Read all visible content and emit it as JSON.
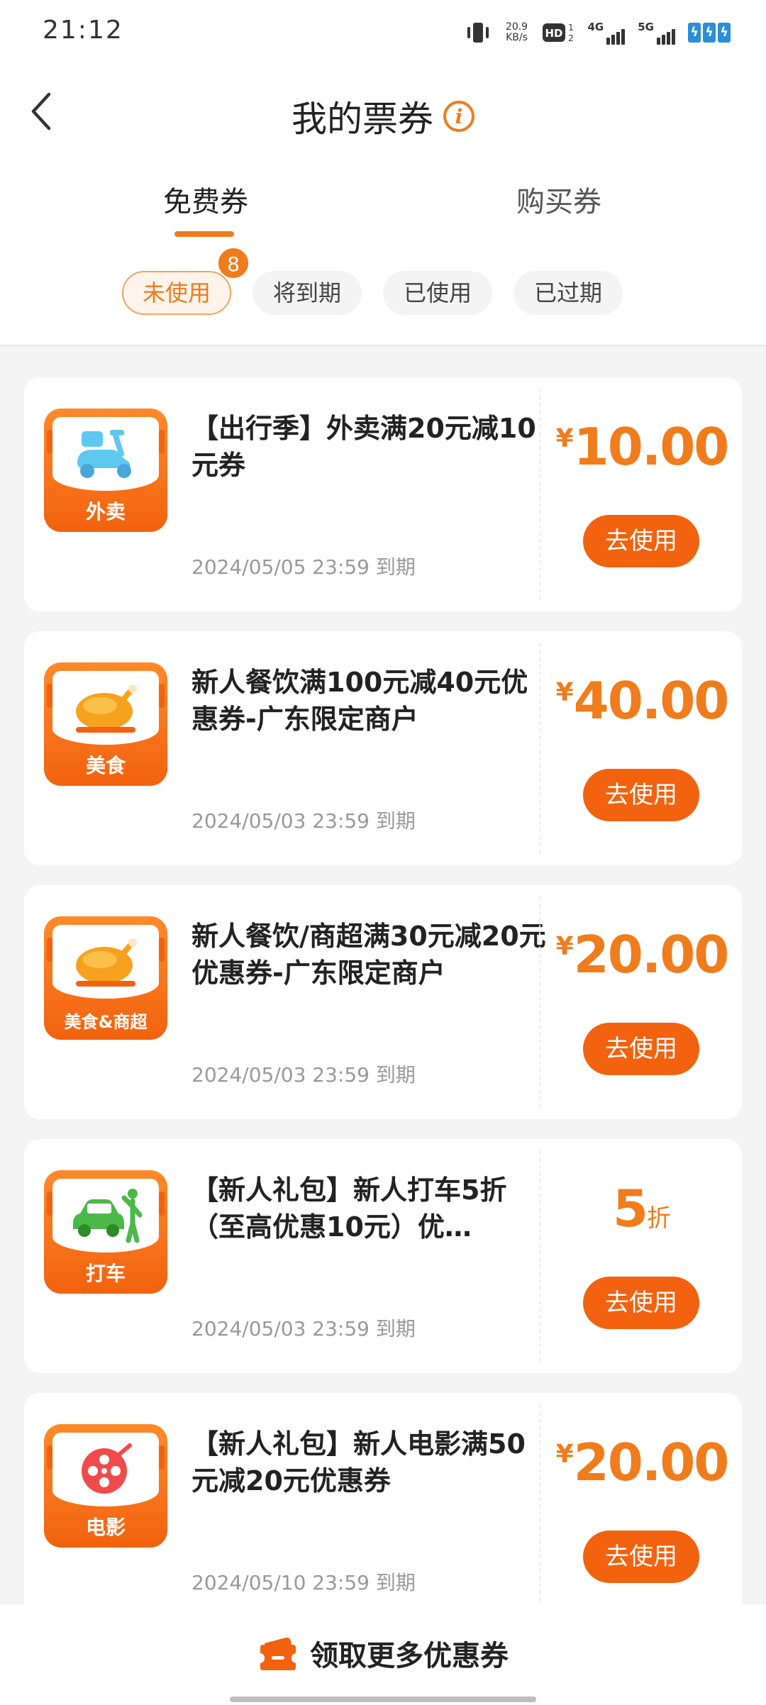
{
  "status_bar": {
    "time": "21:12",
    "net_speed_value": "20.9",
    "net_speed_unit": "KB/s",
    "hd_label": "HD",
    "sim1_label": "4G",
    "sim2_label": "5G"
  },
  "header": {
    "title": "我的票券",
    "info_symbol": "i"
  },
  "tabs": [
    {
      "label": "免费券",
      "active": true
    },
    {
      "label": "购买券",
      "active": false
    }
  ],
  "filters": [
    {
      "label": "未使用",
      "active": true,
      "badge": "8"
    },
    {
      "label": "将到期",
      "active": false
    },
    {
      "label": "已使用",
      "active": false
    },
    {
      "label": "已过期",
      "active": false
    }
  ],
  "coupons": [
    {
      "category": "外卖",
      "icon": "scooter-icon",
      "title": "【出行季】外卖满20元减10元券",
      "expiry": "2024/05/05 23:59 到期",
      "currency": "¥",
      "value": "10.00",
      "unit": "",
      "button": "去使用"
    },
    {
      "category": "美食",
      "icon": "roast-chicken-icon",
      "title": "新人餐饮满100元减40元优惠券-广东限定商户",
      "expiry": "2024/05/03 23:59 到期",
      "currency": "¥",
      "value": "40.00",
      "unit": "",
      "button": "去使用"
    },
    {
      "category": "美食&商超",
      "icon": "roast-chicken-icon",
      "title": "新人餐饮/商超满30元减20元优惠券-广东限定商户",
      "expiry": "2024/05/03 23:59 到期",
      "currency": "¥",
      "value": "20.00",
      "unit": "",
      "button": "去使用"
    },
    {
      "category": "打车",
      "icon": "taxi-icon",
      "title": "【新人礼包】新人打车5折（至高优惠10元）优…",
      "expiry": "2024/05/03 23:59 到期",
      "currency": "",
      "value": "5",
      "unit": "折",
      "button": "去使用"
    },
    {
      "category": "电影",
      "icon": "film-reel-icon",
      "title": "【新人礼包】新人电影满50元减20元优惠券",
      "expiry": "2024/05/10 23:59 到期",
      "currency": "¥",
      "value": "20.00",
      "unit": "",
      "button": "去使用"
    }
  ],
  "bottom": {
    "cta_label": "领取更多优惠券"
  },
  "colors": {
    "accent": "#f07c1c",
    "button": "#f2620f"
  }
}
